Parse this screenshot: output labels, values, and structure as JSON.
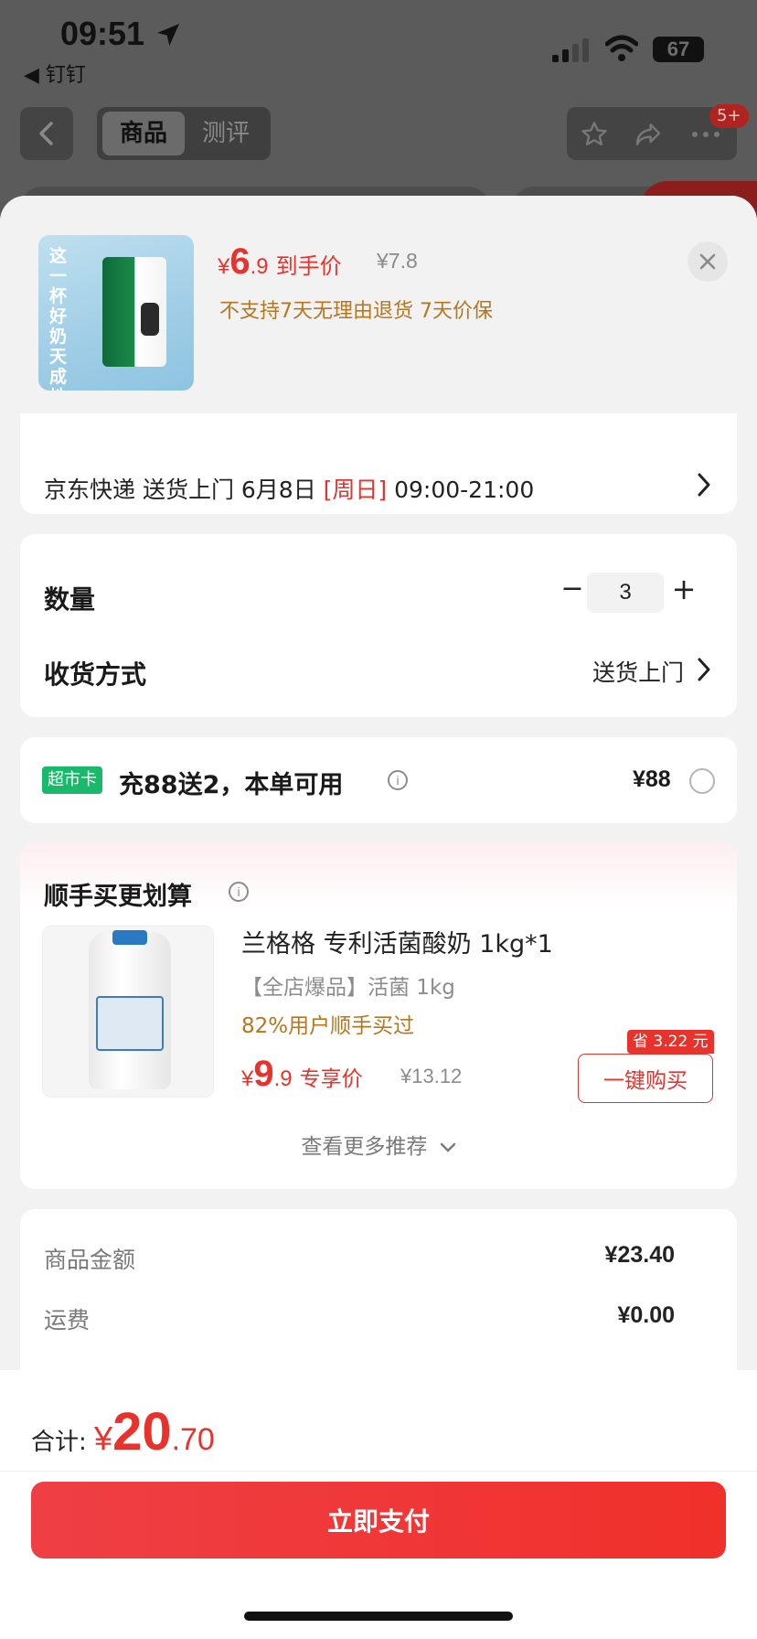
{
  "status_bar": {
    "time": "09:51",
    "back_app": "◀ 钉钉",
    "battery": "67"
  },
  "nav": {
    "tabs": [
      "商品",
      "测评"
    ],
    "badge": "5+"
  },
  "sheet": {
    "product": {
      "thumb_text": "这一杯好奶天成地就",
      "price_currency": "¥",
      "price_int": "6",
      "price_dec": ".9",
      "price_label": "到手价",
      "old_price": "¥7.8",
      "policy": "不支持7天无理由退货   7天价保"
    },
    "delivery": {
      "carrier": "京东快递 送货上门 6月8日 ",
      "weekday": "[周日]",
      "window": " 09:00-21:00"
    },
    "quantity": {
      "label": "数量",
      "minus": "−",
      "value": "3",
      "plus": "+"
    },
    "receive": {
      "label": "收货方式",
      "value": "送货上门"
    },
    "promo": {
      "tag": "超市卡",
      "text": "充88送2，本单可用",
      "info": "i",
      "price": "¥88"
    },
    "recommend": {
      "title": "顺手买更划算",
      "info": "i",
      "item": {
        "name": "兰格格 专利活菌酸奶 1kg*1",
        "sub": "【全店爆品】活菌 1kg",
        "stat": "82%用户顺手买过",
        "price_currency": "¥",
        "price_int": "9",
        "price_dec": ".9",
        "price_label": "专享价",
        "old_price": "¥13.12",
        "save_badge": "省 3.22 元",
        "buy_label": "一键购买"
      },
      "more": "查看更多推荐"
    },
    "summary": [
      {
        "label": "商品金额",
        "value": "¥23.40"
      },
      {
        "label": "运费",
        "value": "¥0.00"
      }
    ]
  },
  "paybar": {
    "total_label": "合计: ",
    "total_currency": "¥",
    "total_int": "20",
    "total_dec": ".70",
    "pay_label": "立即支付"
  }
}
